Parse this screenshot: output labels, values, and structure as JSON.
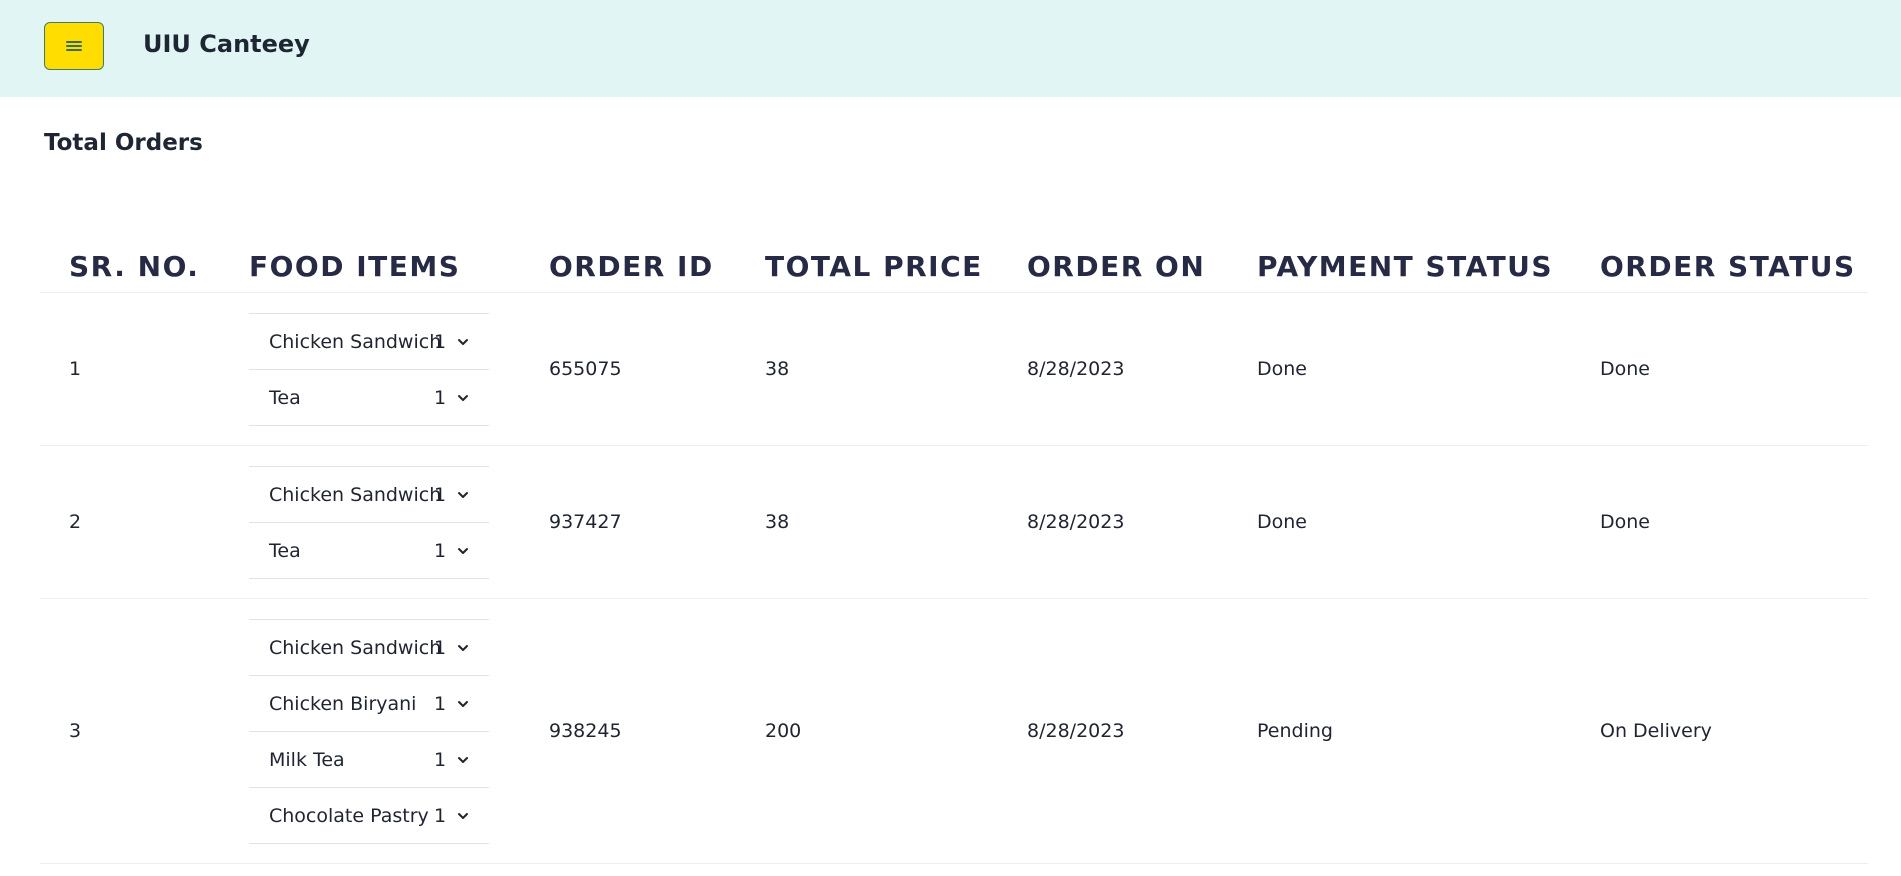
{
  "app": {
    "title": "UIU Canteey",
    "menu_icon": "hamburger-icon"
  },
  "page": {
    "title": "Total Orders"
  },
  "table": {
    "headers": [
      "SR. NO.",
      "FOOD ITEMS",
      "ORDER ID",
      "TOTAL PRICE",
      "ORDER ON",
      "PAYMENT STATUS",
      "ORDER STATUS"
    ],
    "rows": [
      {
        "sr": "1",
        "items": [
          {
            "name": "Chicken Sandwich",
            "qty": "1"
          },
          {
            "name": "Tea",
            "qty": "1"
          }
        ],
        "order_id": "655075",
        "total_price": "38",
        "order_on": "8/28/2023",
        "payment_status": "Done",
        "order_status": "Done"
      },
      {
        "sr": "2",
        "items": [
          {
            "name": "Chicken Sandwich",
            "qty": "1"
          },
          {
            "name": "Tea",
            "qty": "1"
          }
        ],
        "order_id": "937427",
        "total_price": "38",
        "order_on": "8/28/2023",
        "payment_status": "Done",
        "order_status": "Done"
      },
      {
        "sr": "3",
        "items": [
          {
            "name": "Chicken Sandwich",
            "qty": "1"
          },
          {
            "name": "Chicken Biryani",
            "qty": "1"
          },
          {
            "name": "Milk Tea",
            "qty": "1"
          },
          {
            "name": "Chocolate Pastry",
            "qty": "1"
          }
        ],
        "order_id": "938245",
        "total_price": "200",
        "order_on": "8/28/2023",
        "payment_status": "Pending",
        "order_status": "On Delivery"
      }
    ]
  }
}
